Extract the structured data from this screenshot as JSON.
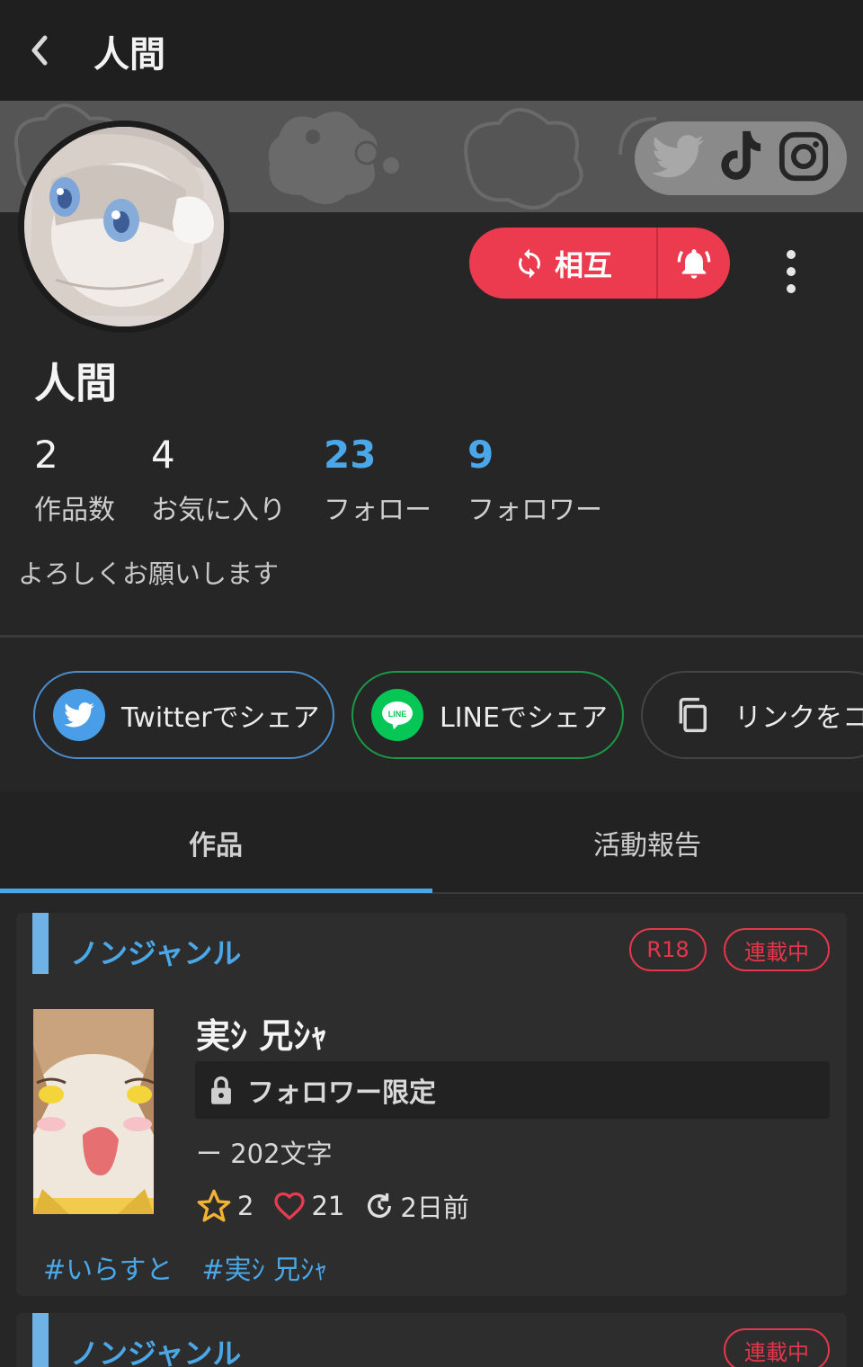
{
  "header": {
    "title": "人間"
  },
  "follow": {
    "label": "相互"
  },
  "profile": {
    "name": "人間",
    "bio": "よろしくお願いします",
    "stats": [
      {
        "value": "2",
        "label": "作品数"
      },
      {
        "value": "4",
        "label": "お気に入り"
      },
      {
        "value": "23",
        "label": "フォロー"
      },
      {
        "value": "9",
        "label": "フォロワー"
      }
    ]
  },
  "share": {
    "twitter": "Twitterでシェア",
    "line": "LINEでシェア",
    "line_icon_text": "LINE",
    "copy": "リンクをコ"
  },
  "tabs": [
    {
      "label": "作品",
      "active": true
    },
    {
      "label": "活動報告",
      "active": false
    }
  ],
  "works": [
    {
      "genre": "ノンジャンル",
      "badges": [
        "R18",
        "連載中"
      ],
      "title": "実ｼ 兄ｼｬ",
      "access": "フォロワー限定",
      "chars": "ー 202文字",
      "stars": "2",
      "likes": "21",
      "updated": "2日前",
      "tags": [
        "#いらすと",
        "#実ｼ 兄ｼｬ"
      ]
    },
    {
      "genre": "ノンジャンル",
      "badges": [
        "連載中"
      ]
    }
  ],
  "colors": {
    "accent": "#4aa8e8",
    "danger": "#ec3a4f",
    "line_green": "#06c755",
    "twitter_blue": "#4a9ee8"
  }
}
